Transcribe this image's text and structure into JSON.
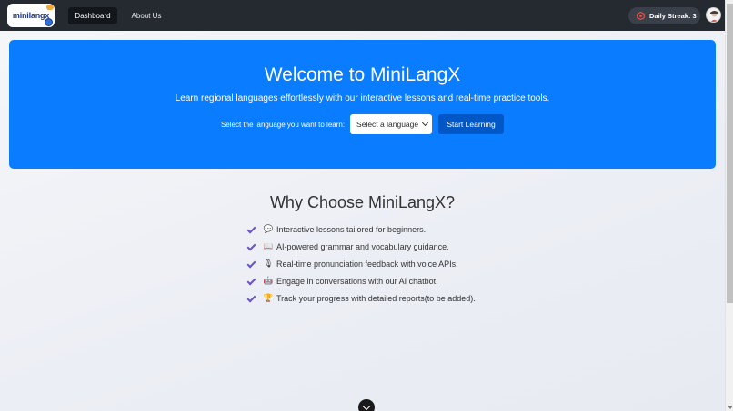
{
  "app": {
    "logo_text": "minilangx"
  },
  "nav": {
    "items": [
      {
        "label": "Dashboard",
        "active": true
      },
      {
        "label": "About Us",
        "active": false
      }
    ],
    "streak_label": "Daily Streak: 3",
    "streak_icon": "streak-icon",
    "avatar_icon": "user-avatar-icon"
  },
  "hero": {
    "title": "Welcome to MiniLangX",
    "subtitle": "Learn regional languages effortlessly with our interactive lessons and real-time practice tools.",
    "select_label": "Select the language you want to learn:",
    "select_value": "Select a language",
    "start_button": "Start Learning",
    "background_color": "#0a7cff",
    "button_color": "#0257c7"
  },
  "why": {
    "title": "Why Choose MiniLangX?",
    "features": [
      {
        "icon": "💬",
        "icon_name": "speech-bubble-icon",
        "text": "Interactive lessons tailored for beginners."
      },
      {
        "icon": "📖",
        "icon_name": "book-icon",
        "text": "AI-powered grammar and vocabulary guidance."
      },
      {
        "icon": "🎙",
        "icon_name": "microphone-icon",
        "text": "Real-time pronunciation feedback with voice APIs."
      },
      {
        "icon": "🤖",
        "icon_name": "robot-icon",
        "text": "Engage in conversations with our AI chatbot."
      },
      {
        "icon": "🏆",
        "icon_name": "trophy-icon",
        "text": "Track your progress with detailed reports(to be added)."
      }
    ],
    "check_color": "#6a52c9"
  }
}
